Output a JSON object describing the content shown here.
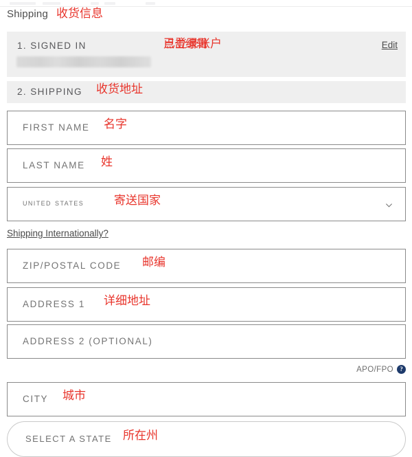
{
  "page": {
    "title": "Shipping",
    "title_annotation": "收货信息"
  },
  "signed_in_section": {
    "label": "1. SIGNED IN",
    "annotation": "已登录账户",
    "account_redacted": "",
    "edit_label": "Edit",
    "edit_annotation": "点击编辑"
  },
  "shipping_section": {
    "label": "2. SHIPPING",
    "annotation": "收货地址"
  },
  "fields": {
    "first_name": {
      "label": "FIRST NAME",
      "annotation": "名字",
      "value": ""
    },
    "last_name": {
      "label": "LAST NAME",
      "annotation": "姓",
      "value": ""
    },
    "country": {
      "label": "United States",
      "annotation": "寄送国家",
      "icon": "chevron-down-icon"
    },
    "zip": {
      "label": "ZIP/POSTAL CODE",
      "annotation": "邮编",
      "value": ""
    },
    "address1": {
      "label": "ADDRESS 1",
      "annotation": "详细地址",
      "value": ""
    },
    "address2": {
      "label": "ADDRESS 2 (OPTIONAL)",
      "annotation": "",
      "value": ""
    },
    "city": {
      "label": "CITY",
      "annotation": "城市",
      "value": ""
    },
    "state": {
      "label": "SELECT A STATE",
      "annotation": "所在州",
      "value": ""
    }
  },
  "links": {
    "shipping_internationally": "Shipping Internationally?"
  },
  "apo": {
    "text": "APO/FPO",
    "help_glyph": "?"
  },
  "colors": {
    "annotation_red": "#e8352c",
    "section_bar_grey": "#efefef",
    "field_border": "#8a8a8a",
    "help_icon_navy": "#1d3a6b"
  }
}
